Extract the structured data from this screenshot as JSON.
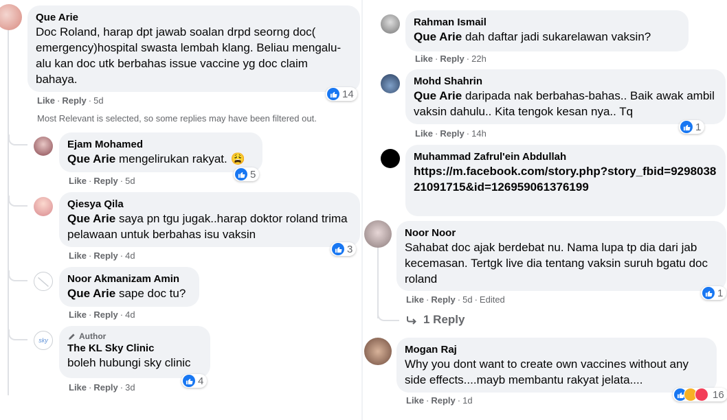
{
  "left": {
    "top_comment": {
      "author": "Que Arie",
      "text": "Doc Roland, harap dpt jawab soalan drpd seorng doc( emergency)hospital swasta lembah klang. Beliau mengalu-alu kan doc utk berbahas issue vaccine yg doc claim bahaya.",
      "like": "Like",
      "reply": "Reply",
      "time": "5d",
      "reactions": "14"
    },
    "filter_note": "Most Relevant is selected, so some replies may have been filtered out.",
    "replies": [
      {
        "author": "Ejam Mohamed",
        "mention": "Que Arie",
        "text": " mengelirukan rakyat. 😩",
        "like": "Like",
        "reply": "Reply",
        "time": "5d",
        "reactions": "5"
      },
      {
        "author": "Qiesya Qila",
        "mention": "Que Arie",
        "text": " saya pn tgu jugak..harap doktor roland trima pelawaan untuk berbahas isu vaksin",
        "like": "Like",
        "reply": "Reply",
        "time": "4d",
        "reactions": "3"
      },
      {
        "author": "Noor Akmanizam Amin",
        "mention": "Que Arie",
        "text": " sape doc tu?",
        "like": "Like",
        "reply": "Reply",
        "time": "4d",
        "reactions": ""
      },
      {
        "badge": "Author",
        "author": "The KL Sky Clinic",
        "mention": "",
        "text": "boleh hubungi sky clinic",
        "like": "Like",
        "reply": "Reply",
        "time": "3d",
        "reactions": "4"
      }
    ]
  },
  "right": {
    "comments": [
      {
        "author": "Rahman Ismail",
        "mention": "Que Arie",
        "text": " dah daftar jadi sukarelawan vaksin?",
        "like": "Like",
        "reply": "Reply",
        "time": "22h",
        "reactions": ""
      },
      {
        "author": "Mohd Shahrin",
        "mention": "Que Arie",
        "text": " daripada nak berbahas-bahas.. Baik awak ambil vaksin dahulu.. Kita tengok kesan nya.. Tq",
        "like": "Like",
        "reply": "Reply",
        "time": "14h",
        "reactions": "1"
      },
      {
        "author": "Muhammad Zafrul'ein Abdullah",
        "mention": "",
        "text": "https://m.facebook.com/story.php?story_fbid=929803821091715&id=126959061376199",
        "like": "",
        "reply": "",
        "time": "",
        "reactions": ""
      },
      {
        "author": "Noor Noor",
        "mention": "",
        "text": "Sahabat doc ajak berdebat nu. Nama lupa tp dia dari jab kecemasan. Tertgk live dia tentang vaksin suruh bgatu doc roland",
        "like": "Like",
        "reply": "Reply",
        "time": "5d",
        "edited": "Edited",
        "reactions": "1"
      },
      {
        "author": "Mogan Raj",
        "mention": "",
        "text": "Why you dont want to create own vaccines without any side effects....mayb membantu rakyat jelata....",
        "like": "Like",
        "reply": "Reply",
        "time": "1d",
        "reactions": "16"
      }
    ],
    "reply_link": "1 Reply"
  },
  "colors": {
    "bubble": "#f0f2f5",
    "like_blue": "#1877f2",
    "meta": "#65676b"
  }
}
